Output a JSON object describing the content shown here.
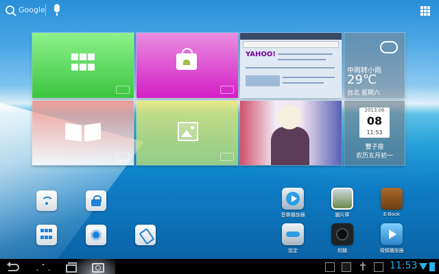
{
  "search": {
    "label": "Google"
  },
  "tiles": {
    "weather": {
      "desc": "中雨转小雨",
      "temp": "29℃",
      "location": "台北 星期六"
    },
    "calendar": {
      "month": "2013.06",
      "day": "08",
      "time": "11:53",
      "sign": "雙子座",
      "lunar": "农历五月初一"
    },
    "browser": {
      "logo": "YAHOO!"
    }
  },
  "apps": [
    {
      "label": "音樂播放器"
    },
    {
      "label": "圖片庫"
    },
    {
      "label": "E-Book"
    },
    {
      "label": "設定"
    },
    {
      "label": "相機"
    },
    {
      "label": "視頻播放器"
    }
  ],
  "status": {
    "time": "11:53",
    "accent": "#28b0f0"
  }
}
